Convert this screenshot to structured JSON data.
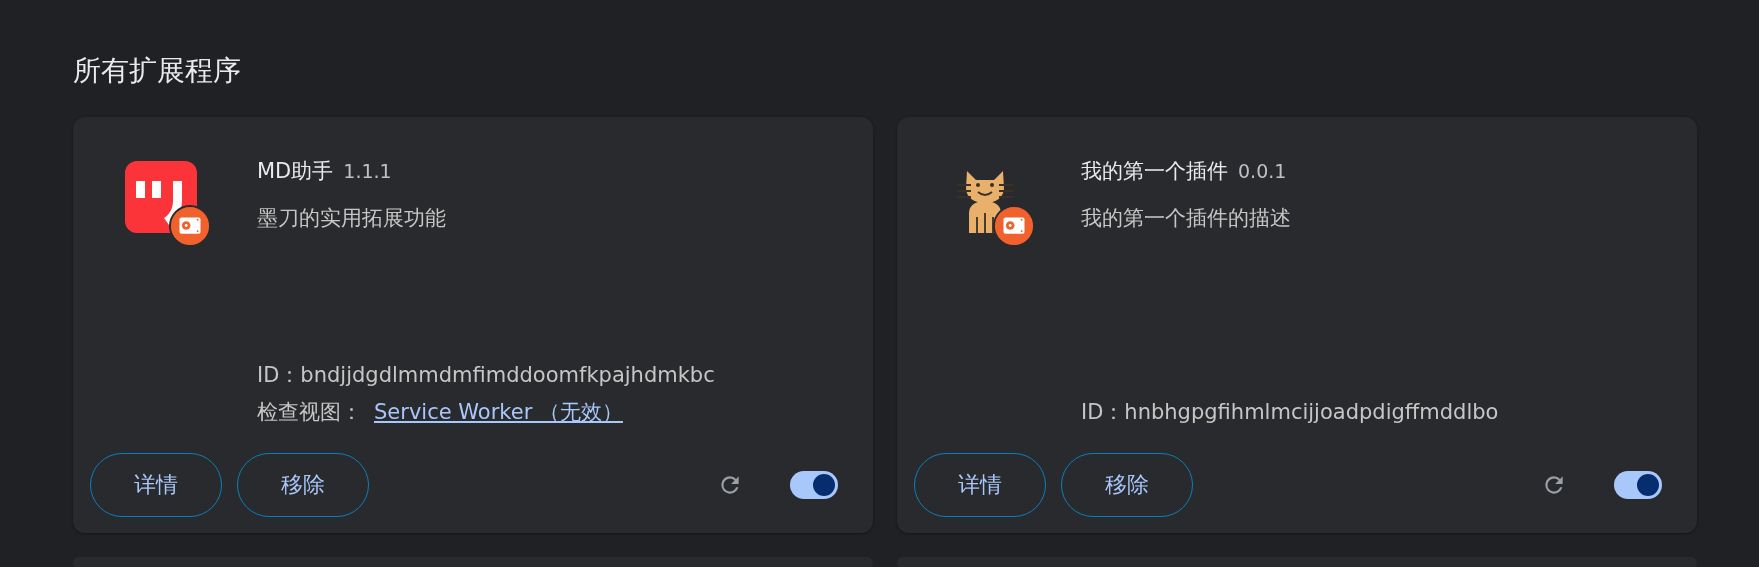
{
  "section_title": "所有扩展程序",
  "extensions": [
    {
      "kind": "md",
      "developer_badge": true,
      "name": "MD助手",
      "version": "1.1.1",
      "description": "墨刀的实用拓展功能",
      "id_label": "ID：",
      "id": "bndjjdgdlmmdmfimddoomfkpajhdmkbc",
      "inspect_label": "检查视图：",
      "inspect_link": "Service Worker （无效）",
      "buttons": [
        "详情",
        "移除"
      ],
      "enabled": true
    },
    {
      "kind": "cat",
      "developer_badge": true,
      "name": "我的第一个插件",
      "version": "0.0.1",
      "description": "我的第一个插件的描述",
      "id_label": "ID：",
      "id": "hnbhgpgfihmlmcijjoadpdigffmddlbo",
      "buttons": [
        "详情",
        "移除"
      ],
      "enabled": true
    }
  ]
}
